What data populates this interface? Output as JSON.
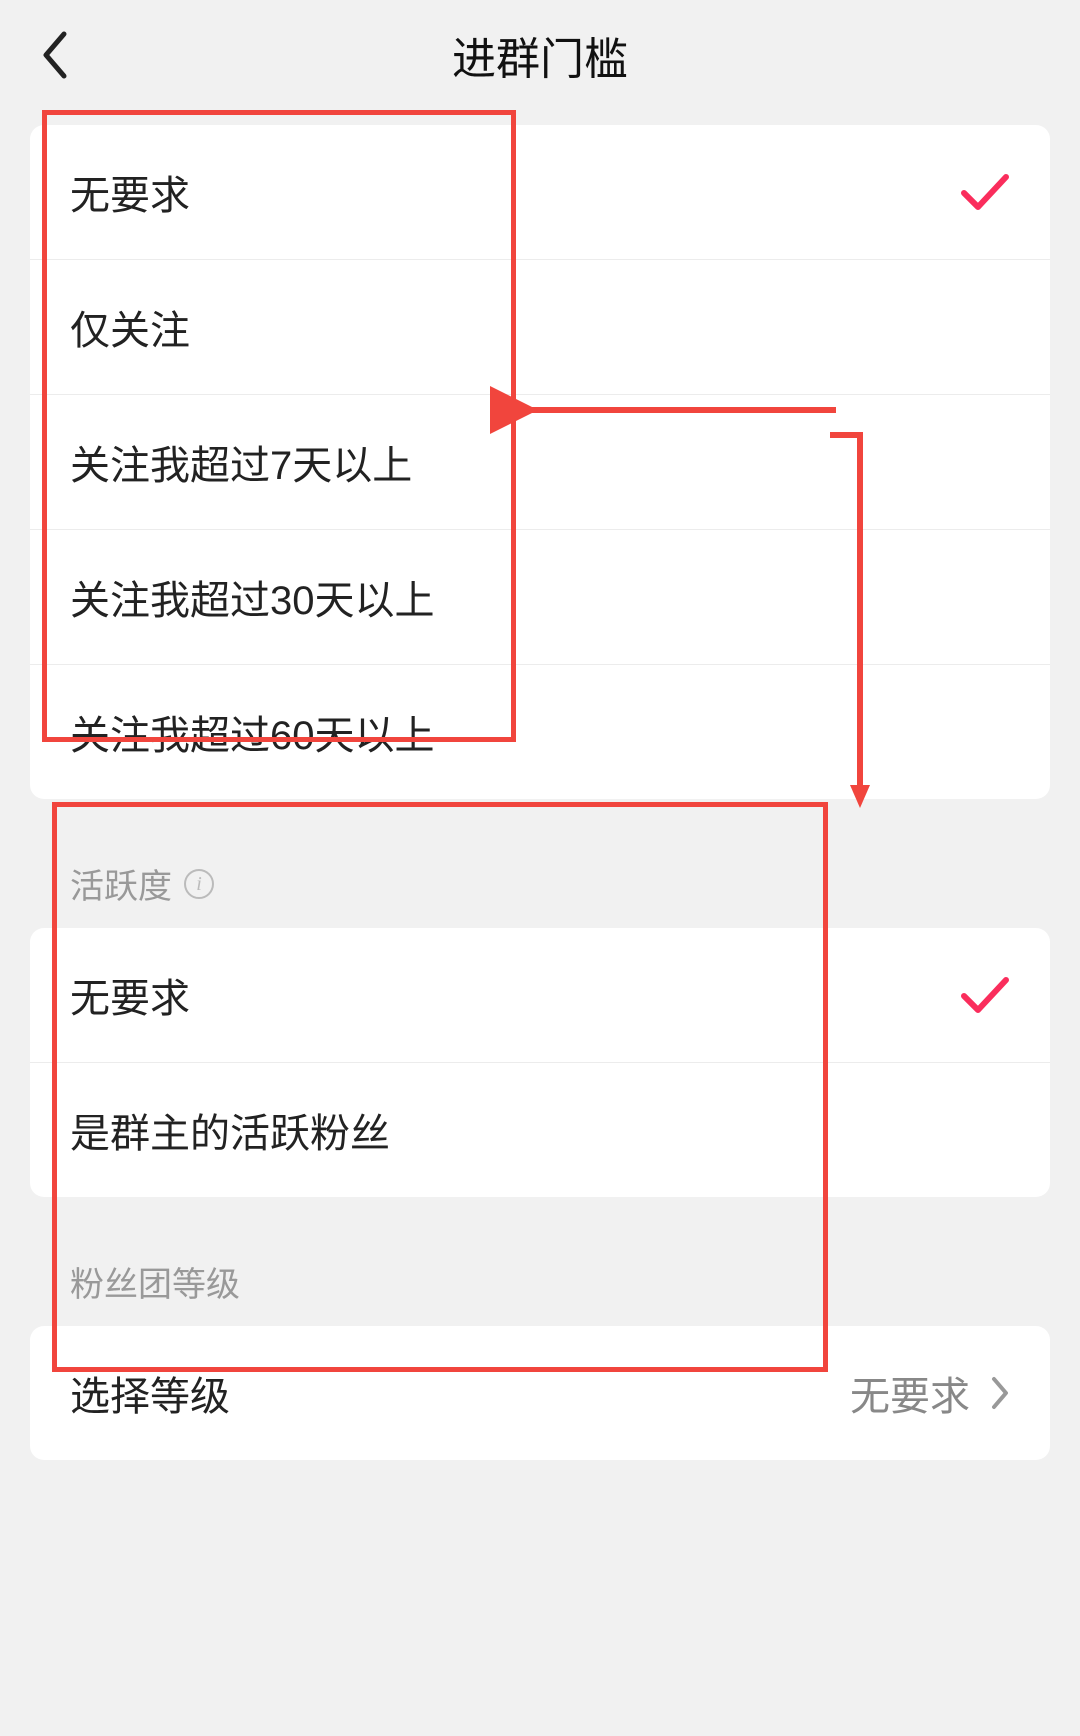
{
  "header": {
    "title": "进群门槛"
  },
  "follow_section": {
    "options": [
      {
        "label": "无要求",
        "selected": true
      },
      {
        "label": "仅关注",
        "selected": false
      },
      {
        "label": "关注我超过7天以上",
        "selected": false
      },
      {
        "label": "关注我超过30天以上",
        "selected": false
      },
      {
        "label": "关注我超过60天以上",
        "selected": false
      }
    ]
  },
  "activity_section": {
    "heading": "活跃度",
    "options": [
      {
        "label": "无要求",
        "selected": true
      },
      {
        "label": "是群主的活跃粉丝",
        "selected": false
      }
    ]
  },
  "fan_level_section": {
    "heading": "粉丝团等级",
    "row": {
      "label": "选择等级",
      "value": "无要求"
    }
  },
  "colors": {
    "accent": "#fa2d5c",
    "annotation": "#f1453d"
  }
}
